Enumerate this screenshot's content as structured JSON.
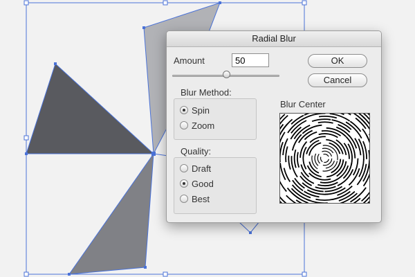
{
  "dialog": {
    "title": "Radial Blur",
    "amount_label": "Amount",
    "amount_value": "50",
    "amount_slider_fraction": 0.5,
    "ok_label": "OK",
    "cancel_label": "Cancel",
    "blur_method": {
      "label": "Blur Method:",
      "options": [
        "Spin",
        "Zoom"
      ],
      "selected": "Spin"
    },
    "quality": {
      "label": "Quality:",
      "options": [
        "Draft",
        "Good",
        "Best"
      ],
      "selected": "Good"
    },
    "blur_center_label": "Blur Center"
  },
  "colors": {
    "background": "#f2f2f2",
    "selection_blue": "#4a72d8",
    "shape_dark": "#595a5f",
    "shape_mid": "#808186",
    "shape_light": "#b1b2b6"
  }
}
